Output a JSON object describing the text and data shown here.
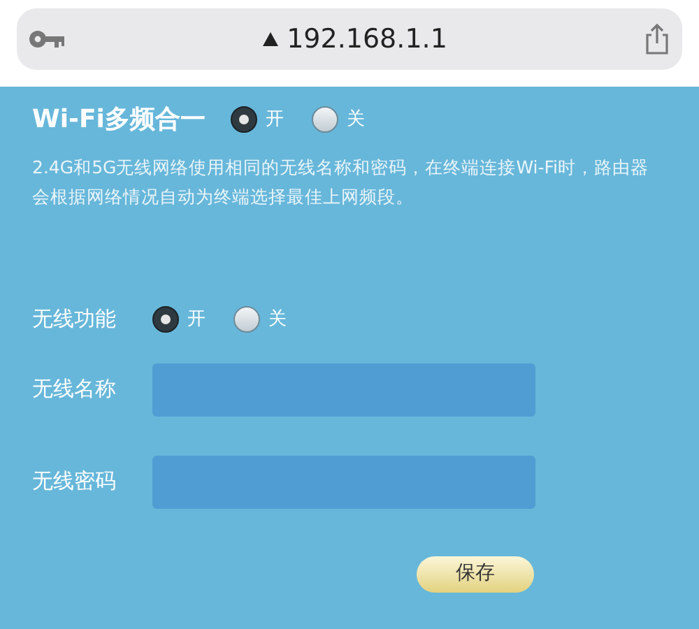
{
  "address_bar": {
    "url": "192.168.1.1"
  },
  "multiband": {
    "label": "Wi-Fi多频合一",
    "options": [
      {
        "label": "开",
        "selected": true
      },
      {
        "label": "关",
        "selected": false
      }
    ],
    "description": "2.4G和5G无线网络使用相同的无线名称和密码，在终端连接Wi-Fi时，路由器会根据网络情况自动为终端选择最佳上网频段。"
  },
  "wireless": {
    "label": "无线功能",
    "options": [
      {
        "label": "开",
        "selected": true
      },
      {
        "label": "关",
        "selected": false
      }
    ]
  },
  "fields": [
    {
      "label": "无线名称"
    },
    {
      "label": "无线密码"
    }
  ],
  "save_button": "保存"
}
